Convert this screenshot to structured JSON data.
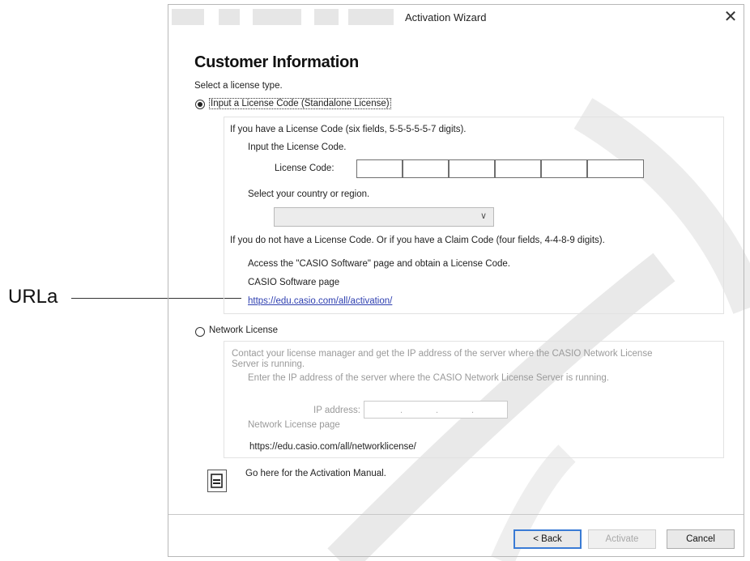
{
  "callout": {
    "label": "URLa"
  },
  "window": {
    "title": "Activation Wizard",
    "close": "✕"
  },
  "page": {
    "heading": "Customer Information",
    "select_type": "Select a license type."
  },
  "standalone": {
    "radio_label": "Input a License Code (Standalone License)",
    "selected": true,
    "have_code": "If you have a License Code (six fields, 5-5-5-5-5-7 digits).",
    "input_prompt": "Input the License Code.",
    "code_label": "License Code:",
    "code_fields": [
      "",
      "",
      "",
      "",
      "",
      ""
    ],
    "country_prompt": "Select your country or region.",
    "country_value": "",
    "no_code": "If you do not have a License Code. Or if you have a Claim Code (four fields, 4-4-8-9 digits).",
    "access_text": "Access the \"CASIO Software\" page and obtain a License Code.",
    "software_page": "CASIO Software page",
    "software_url": "https://edu.casio.com/all/activation/"
  },
  "network": {
    "radio_label": "Network License",
    "selected": false,
    "contact_line1": "Contact your license manager and get the IP address of the server where the CASIO Network License",
    "contact_line2": "Server is running.",
    "enter_ip": "Enter the IP address of the server where the CASIO Network License Server is running.",
    "ip_label": "IP address:",
    "ip_value": "",
    "page_label": "Network License page",
    "url": "https://edu.casio.com/all/networklicense/"
  },
  "manual": {
    "text": "Go here for the Activation Manual."
  },
  "buttons": {
    "back": "< Back",
    "activate": "Activate",
    "cancel": "Cancel"
  }
}
